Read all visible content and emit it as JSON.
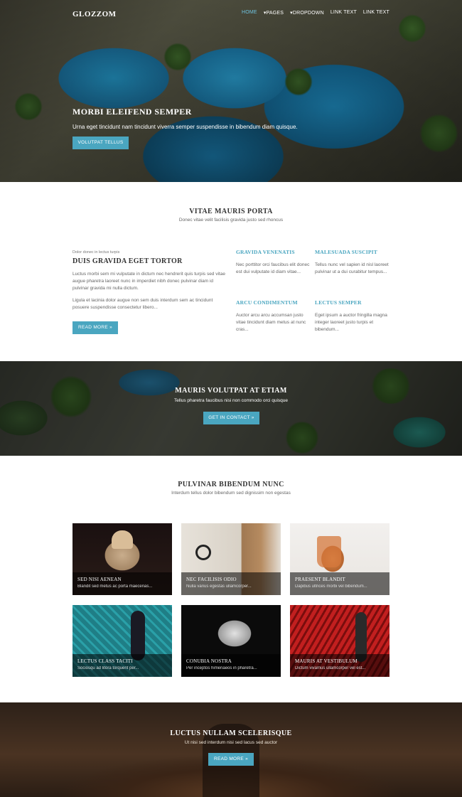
{
  "header": {
    "logo": "GLOZZOM",
    "nav": [
      {
        "label": "HOME",
        "active": true
      },
      {
        "label": "▾PAGES",
        "active": false
      },
      {
        "label": "▾DROPDOWN",
        "active": false
      },
      {
        "label": "LINK TEXT",
        "active": false
      },
      {
        "label": "LINK TEXT",
        "active": false
      }
    ]
  },
  "hero": {
    "title": "MORBI ELEIFEND SEMPER",
    "subtitle": "Urna eget tincidunt nam tincidunt viverra semper suspendisse in bibendum diam quisque.",
    "button": "VOLUTPAT TELLUS"
  },
  "intro": {
    "title": "VITAE MAURIS PORTA",
    "subtitle": "Donec vitae velit facilisis gravida justo sed rhoncus"
  },
  "feature": {
    "kicker": "Dolor donec in lectus turpis",
    "title": "DUIS GRAVIDA EGET TORTOR",
    "para1": "Luctus morbi sem mi vulputate in dictum nec hendrerit quis turpis sed vitae augue pharetra laoreet nunc in imperdiet nibh donec pulvinar diam id pulvinar gravida mi nulla dictum.",
    "para2": "Ligula et lacinia dolor augue non sem duis interdum sem ac tincidunt posuere suspendisse consectetur libero...",
    "button": "READ MORE »"
  },
  "columns": [
    {
      "title": "GRAVIDA VENENATIS",
      "text": "Nec porttitor orci faucibus elit donec est dui vulputate id diam vitae..."
    },
    {
      "title": "MALESUADA SUSCIPIT",
      "text": "Tellus nunc vel sapien id nisl laoreet pulvinar ut a dui curabitur tempus..."
    },
    {
      "title": "ARCU CONDIMENTUM",
      "text": "Auctor arcu arcu accumsan justo vitae tincidunt diam metus at nunc cras..."
    },
    {
      "title": "LECTUS SEMPER",
      "text": "Eget ipsum a auctor fringilla magna integer laoreet justo turpis et bibendum..."
    }
  ],
  "band": {
    "title": "MAURIS VOLUTPAT AT ETIAM",
    "subtitle": "Tellus pharetra faucibus nisi non commodo orci quisque",
    "button": "GET IN CONTACT »"
  },
  "gallery": {
    "title": "PULVINAR BIBENDUM NUNC",
    "subtitle": "Interdum tellus dolor bibendum sed dignissim non egestas",
    "items": [
      {
        "title": "SED NISI AENEAN",
        "text": "Blandit sed metus ac porta maecenas..."
      },
      {
        "title": "NEC FACILISIS ODIO",
        "text": "Nulla varius egestas ullamcorper..."
      },
      {
        "title": "PRAESENT BLANDIT",
        "text": "Dapibus ultrices morbi vel bibendum..."
      },
      {
        "title": "LECTUS CLASS TACITI",
        "text": "Sociosqu ad litora torquent per..."
      },
      {
        "title": "CONUBIA NOSTRA",
        "text": "Per inceptos himenaeos in pharetra..."
      },
      {
        "title": "MAURIS AT VESTIBULUM",
        "text": "Dictum vivamus ullamcorper vel est..."
      }
    ]
  },
  "footer_band": {
    "title": "LUCTUS NULLAM SCELERISQUE",
    "subtitle": "Ut nisi sed interdum nisi sed lacus sed auctor",
    "button": "READ MORE »"
  },
  "colors": {
    "accent": "#4aa6c0",
    "heading": "#333333"
  }
}
